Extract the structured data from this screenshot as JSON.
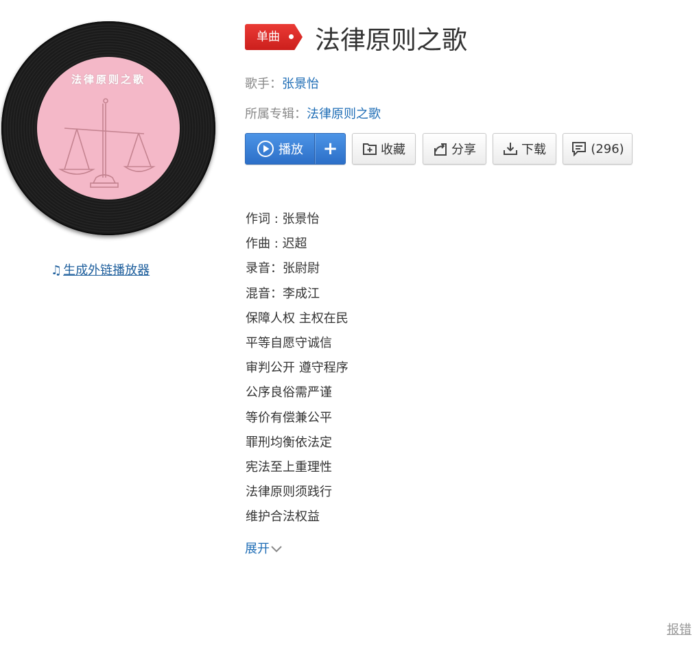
{
  "cover": {
    "label_text": "法律原则之歌"
  },
  "external_player_link": "生成外链播放器",
  "song": {
    "type_tag": "单曲",
    "title": "法律原则之歌",
    "singer_label": "歌手：",
    "singer": "张景怡",
    "album_label": "所属专辑：",
    "album": "法律原则之歌"
  },
  "actions": {
    "play": "播放",
    "add": "+",
    "collect": "收藏",
    "share": "分享",
    "download": "下载",
    "comments": "(296)"
  },
  "lyrics": [
    "作词 : 张景怡",
    "作曲 : 迟超",
    "录音：张尉尉",
    "混音：李成江",
    "保障人权 主权在民",
    "平等自愿守诚信",
    "审判公开 遵守程序",
    "公序良俗需严谨",
    "等价有偿兼公平",
    "罪刑均衡依法定",
    "宪法至上重理性",
    "法律原则须践行",
    "维护合法权益"
  ],
  "expand": "展开",
  "report": "报错",
  "colors": {
    "tag_red": "#d9261f",
    "link_blue": "#1d6cb5",
    "play_blue": "#3a80d6",
    "label_pink": "#f4b8c8"
  },
  "icons": [
    "music-note-icon",
    "play-circle-icon",
    "plus-icon",
    "folder-plus-icon",
    "share-icon",
    "download-icon",
    "comment-icon",
    "chevron-down-icon",
    "scale-icon"
  ]
}
